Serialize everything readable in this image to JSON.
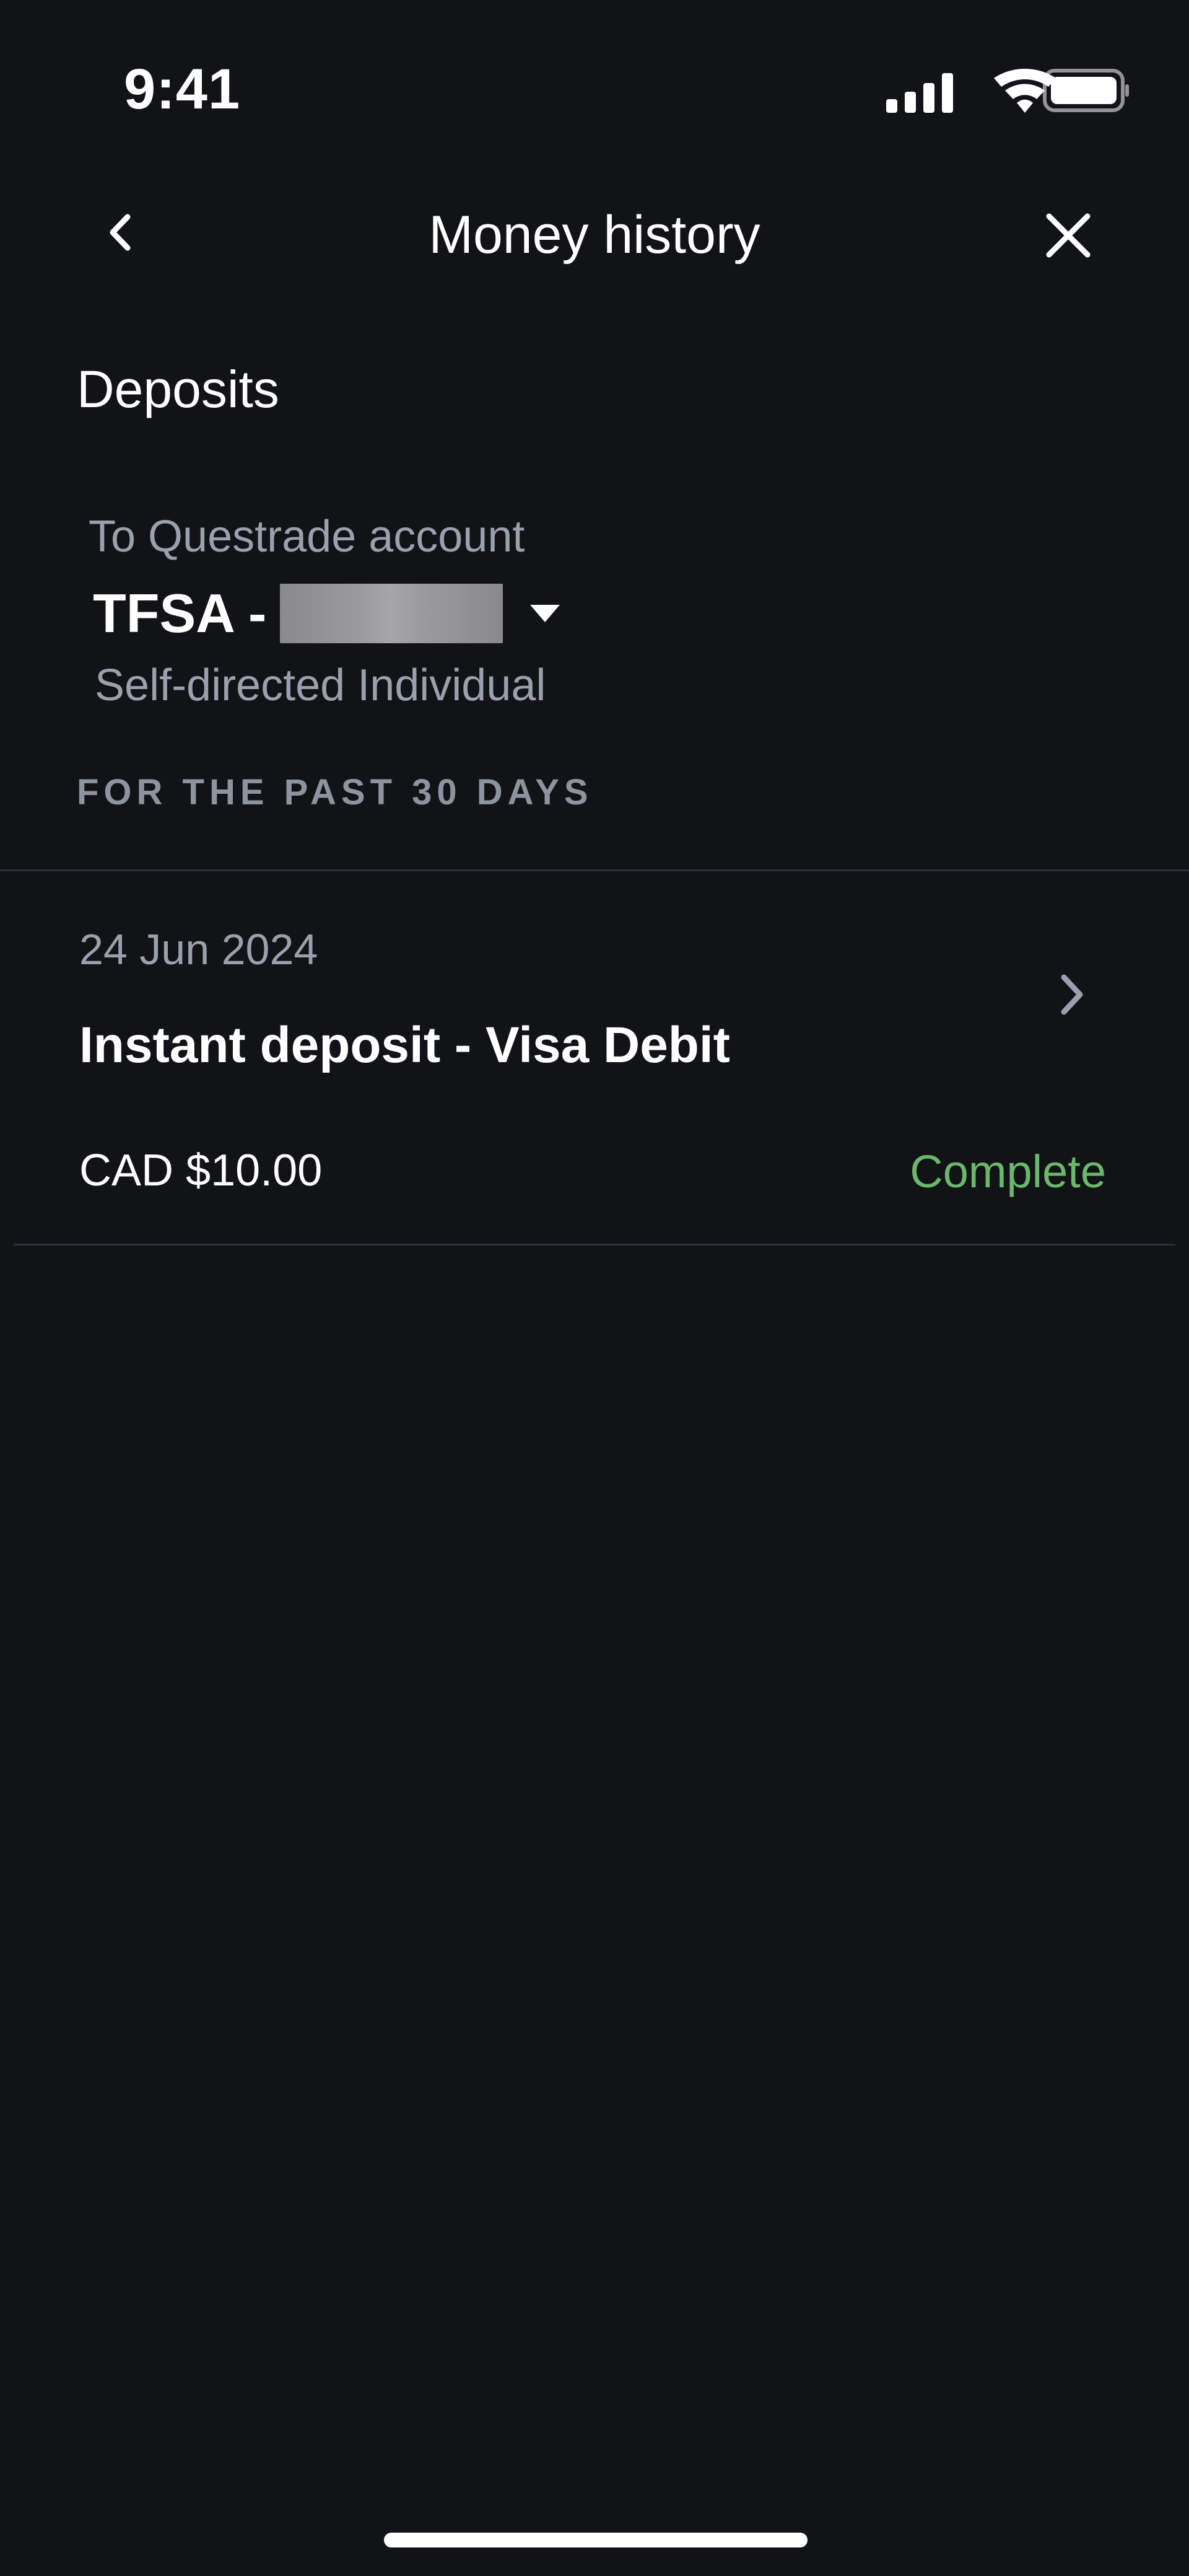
{
  "status_bar": {
    "time": "9:41",
    "icons": [
      "cellular-signal-icon",
      "wifi-icon",
      "battery-icon"
    ]
  },
  "nav": {
    "title": "Money history",
    "back_icon": "chevron-left-icon",
    "close_icon": "close-icon"
  },
  "section": {
    "title": "Deposits"
  },
  "account": {
    "label": "To Questrade account",
    "name": "TFSA -",
    "type": "Self-directed Individual",
    "dropdown_icon": "caret-down-icon"
  },
  "period": {
    "label": "FOR THE PAST 30 DAYS"
  },
  "transactions": [
    {
      "date": "24 Jun 2024",
      "description": "Instant deposit - Visa Debit",
      "amount": "CAD $10.00",
      "status": "Complete"
    }
  ],
  "colors": {
    "background": "#121317",
    "secondary_text": "#9aa0ad",
    "status_complete": "#6ab96b",
    "divider": "#2c2f36"
  }
}
